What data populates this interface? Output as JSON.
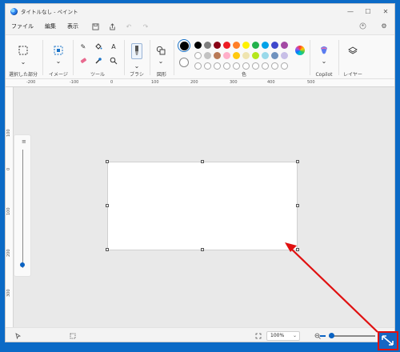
{
  "window": {
    "title": "タイトルなし - ペイント",
    "controls": [
      "—",
      "☐",
      "✕"
    ]
  },
  "menu": {
    "items": [
      "ファイル",
      "編集",
      "表示"
    ]
  },
  "ribbon": {
    "groups": {
      "selection": "選択した部分",
      "image": "イメージ",
      "tools": "ツール",
      "brush": "ブラシ",
      "shapes": "図形",
      "colors": "色",
      "copilot": "Copilot",
      "layers": "レイヤー"
    },
    "palette_row1": [
      "#000000",
      "#7f7f7f",
      "#880015",
      "#ed1c24",
      "#ff7f27",
      "#fff200",
      "#22b14c",
      "#00a2e8",
      "#3f48cc",
      "#a349a4"
    ],
    "palette_row2": [
      "#ffffff",
      "#c3c3c3",
      "#b97a57",
      "#ffaec9",
      "#ffc90e",
      "#efe4b0",
      "#b5e61d",
      "#99d9ea",
      "#7092be",
      "#c8bfe7"
    ]
  },
  "ruler": {
    "horizontal": [
      "-200",
      "-100",
      "0",
      "100",
      "200",
      "300",
      "400",
      "500"
    ],
    "vertical": [
      "100",
      "0",
      "100",
      "200",
      "300"
    ]
  },
  "statusbar": {
    "zoom": "100%",
    "zoom_fill": 0.1
  },
  "annotation": {
    "color": "#e01010"
  }
}
